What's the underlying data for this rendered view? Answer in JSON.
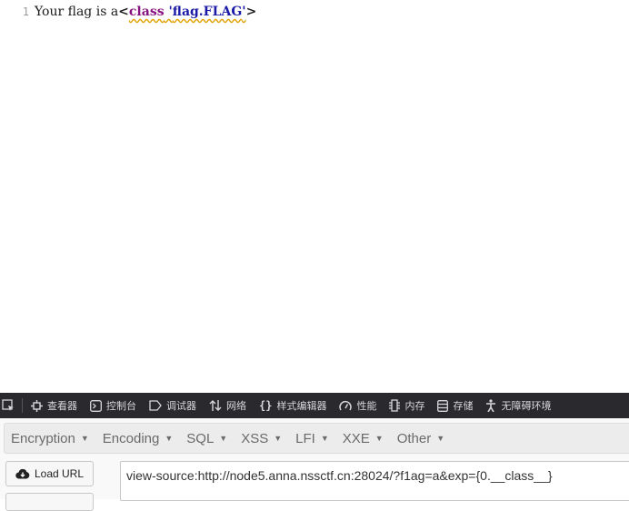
{
  "source": {
    "line_number": "1",
    "text_prefix": "Your flag is a",
    "lt": "<",
    "tag_name": "class",
    "attr_quote_open": " '",
    "attr_value": "flag.FLAG",
    "attr_quote_close": "'",
    "gt": ">"
  },
  "devtools": {
    "inspector_label": "查看器",
    "console_label": "控制台",
    "debugger_label": "调试器",
    "network_label": "网络",
    "style_editor_label": "样式编辑器",
    "performance_label": "性能",
    "memory_label": "内存",
    "storage_label": "存储",
    "accessibility_label": "无障碍环境"
  },
  "hackbar": {
    "menus": [
      "Encryption",
      "Encoding",
      "SQL",
      "XSS",
      "LFI",
      "XXE",
      "Other"
    ],
    "load_url_label": "Load URL",
    "url_value": "view-source:http://node5.anna.nssctf.cn:28024/?f1ag=a&exp={0.__class__}"
  }
}
